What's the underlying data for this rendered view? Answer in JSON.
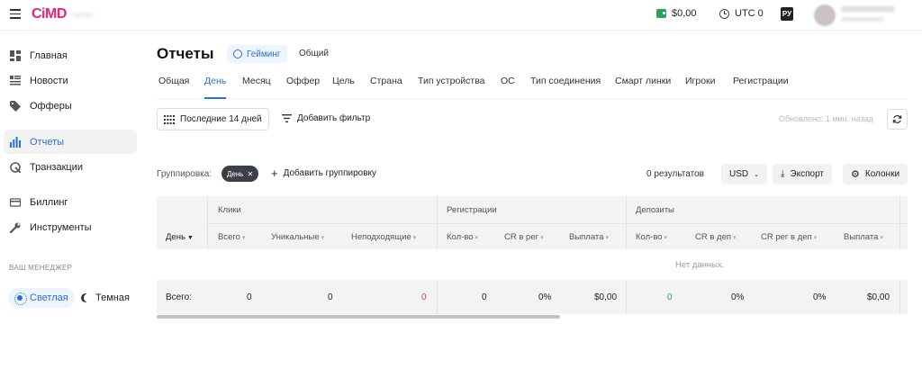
{
  "brand": {
    "logo_text": "CiMD"
  },
  "topbar": {
    "balance": "$0,00",
    "timezone": "UTC 0",
    "language": "РУ"
  },
  "sidebar": {
    "items": [
      {
        "label": "Главная",
        "icon": "dashboard-icon"
      },
      {
        "label": "Новости",
        "icon": "news-icon"
      },
      {
        "label": "Офферы",
        "icon": "tag-icon"
      },
      {
        "label": "Отчеты",
        "icon": "bar-chart-icon",
        "active": true
      },
      {
        "label": "Транзакции",
        "icon": "transactions-icon"
      },
      {
        "label": "Биллинг",
        "icon": "card-icon"
      },
      {
        "label": "Инструменты",
        "icon": "wrench-icon"
      }
    ],
    "manager_label": "ВАШ МЕНЕДЖЕР",
    "theme_light": "Светлая",
    "theme_dark": "Темная"
  },
  "page": {
    "title": "Отчеты",
    "vertical_active": "Гейминг",
    "vertical_other": "Общий"
  },
  "tabs": [
    "Общая",
    "День",
    "Месяц",
    "Оффер",
    "Цель",
    "Страна",
    "Тип устройства",
    "ОС",
    "Тип соединения",
    "Смарт линки",
    "Игроки",
    "Регистрации"
  ],
  "active_tab": "День",
  "filters": {
    "date_range": "Последние 14 дней",
    "add_filter": "Добавить фильтр",
    "updated": "Обновлено: 1 мин. назад"
  },
  "grouping": {
    "label": "Группировка:",
    "chip": "День",
    "add": "Добавить группировку",
    "results": "0  результатов",
    "currency": "USD",
    "export": "Экспорт",
    "columns": "Колонки"
  },
  "table": {
    "groups": [
      "Клики",
      "Регистрации",
      "Депозиты"
    ],
    "columns": [
      "День",
      "Всего",
      "Уникальные",
      "Неподходящие",
      "Кол-во",
      "CR в рег",
      "Выплата",
      "Кол-во",
      "CR в деп",
      "CR рег в деп",
      "Выплата"
    ],
    "empty": "Нет данных.",
    "total_label": "Всего:",
    "totals": [
      "0",
      "0",
      "0",
      "0",
      "0%",
      "$0,00",
      "0",
      "0%",
      "0%",
      "$0,00"
    ]
  },
  "colors": {
    "accent": "#2a6fdb",
    "brand": "#e6247a",
    "negative": "#e53935",
    "positive": "#27a35a"
  }
}
